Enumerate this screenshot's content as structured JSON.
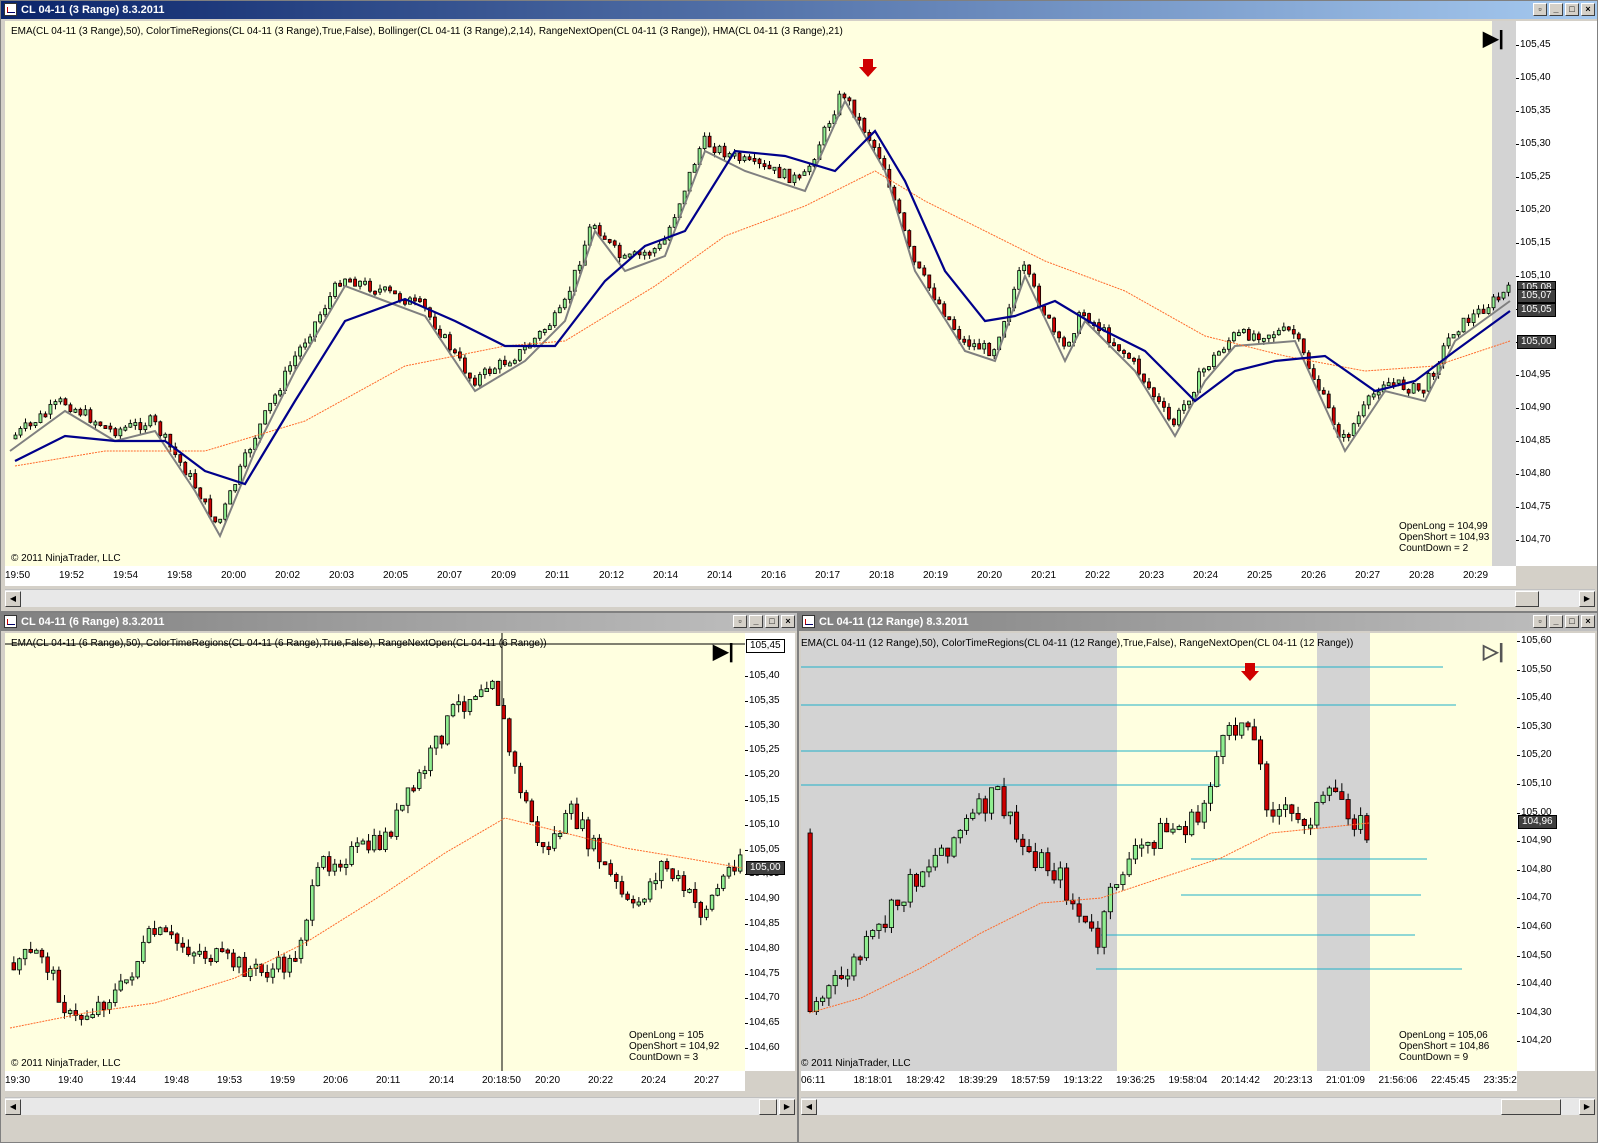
{
  "top": {
    "title": "CL 04-11 (3 Range)  8.3.2011",
    "indicators": "EMA(CL 04-11 (3 Range),50), ColorTimeRegions(CL 04-11 (3 Range),True,False), Bollinger(CL 04-11 (3 Range),2,14), RangeNextOpen(CL 04-11 (3 Range)), HMA(CL 04-11 (3 Range),21)",
    "copyright": "© 2011 NinjaTrader, LLC",
    "stats": [
      "OpenLong = 104,99",
      "OpenShort = 104,93",
      "CountDown = 2"
    ],
    "yticks": [
      "105,45",
      "105,40",
      "105,35",
      "105,30",
      "105,25",
      "105,20",
      "105,15",
      "105,10",
      "105,05",
      "105,00",
      "104,95",
      "104,90",
      "104,85",
      "104,80",
      "104,75",
      "104,70"
    ],
    "price_boxes": [
      "105,08",
      "105,07",
      "105,05",
      "105,00"
    ],
    "xticks": [
      "19:50",
      "19:52",
      "19:54",
      "19:58",
      "20:00",
      "20:02",
      "20:03",
      "20:05",
      "20:07",
      "20:09",
      "20:11",
      "20:12",
      "20:14",
      "20:14",
      "20:16",
      "20:17",
      "20:18",
      "20:19",
      "20:20",
      "20:21",
      "20:22",
      "20:23",
      "20:24",
      "20:25",
      "20:26",
      "20:27",
      "20:28",
      "20:29"
    ],
    "window_buttons": [
      "▫",
      "_",
      "□",
      "×"
    ]
  },
  "bottom_left": {
    "title": "CL 04-11 (6 Range)  8.3.2011",
    "indicators": "EMA(CL 04-11 (6 Range),50), ColorTimeRegions(CL 04-11 (6 Range),True,False), RangeNextOpen(CL 04-11 (6 Range))",
    "copyright": "© 2011 NinjaTrader, LLC",
    "stats": [
      "OpenLong = 105",
      "OpenShort = 104,92",
      "CountDown = 3"
    ],
    "yticks": [
      "105,40",
      "105,35",
      "105,30",
      "105,25",
      "105,20",
      "105,15",
      "105,10",
      "105,05",
      "104,95",
      "104,90",
      "104,85",
      "104,80",
      "104,75",
      "104,70",
      "104,65",
      "104,60"
    ],
    "price_boxes": [
      "105,45",
      "105,00"
    ],
    "xticks": [
      "19:30",
      "19:40",
      "19:44",
      "19:48",
      "19:53",
      "19:59",
      "20:06",
      "20:11",
      "20:14",
      "20:18:50",
      "20:20",
      "20:22",
      "20:24",
      "20:27"
    ],
    "window_buttons": [
      "▫",
      "_",
      "□",
      "×"
    ]
  },
  "bottom_right": {
    "title": "CL 04-11 (12 Range)  8.3.2011",
    "indicators": "EMA(CL 04-11 (12 Range),50), ColorTimeRegions(CL 04-11 (12 Range),True,False), RangeNextOpen(CL 04-11 (12 Range))",
    "copyright": "© 2011 NinjaTrader, LLC",
    "stats": [
      "OpenLong = 105,06",
      "OpenShort = 104,86",
      "CountDown = 9"
    ],
    "yticks": [
      "105,60",
      "105,50",
      "105,40",
      "105,30",
      "105,20",
      "105,10",
      "105,00",
      "104,90",
      "104,80",
      "104,70",
      "104,60",
      "104,50",
      "104,40",
      "104,30",
      "104,20"
    ],
    "price_boxes": [
      "104,96"
    ],
    "xticks": [
      "06:11",
      "18:18:01",
      "18:29:42",
      "18:39:29",
      "18:57:59",
      "19:13:22",
      "19:36:25",
      "19:58:04",
      "20:14:42",
      "20:23:13",
      "21:01:09",
      "21:56:06",
      "22:45:45",
      "23:35:24"
    ],
    "window_buttons": [
      "▫",
      "_",
      "□",
      "×"
    ]
  },
  "colors": {
    "background": "#ffffe0",
    "up_candle": "#90ee90",
    "down_candle": "#cc0000",
    "ema": "#ff6a2a",
    "hma": "#00008b",
    "bollinger": "#808080",
    "session_region": "#d3d3d3",
    "levels": "#20b2c8"
  },
  "icons": [
    "chart-window-icon",
    "go-to-end-icon",
    "red-arrow-down-icon",
    "scroll-left-icon",
    "scroll-right-icon"
  ]
}
